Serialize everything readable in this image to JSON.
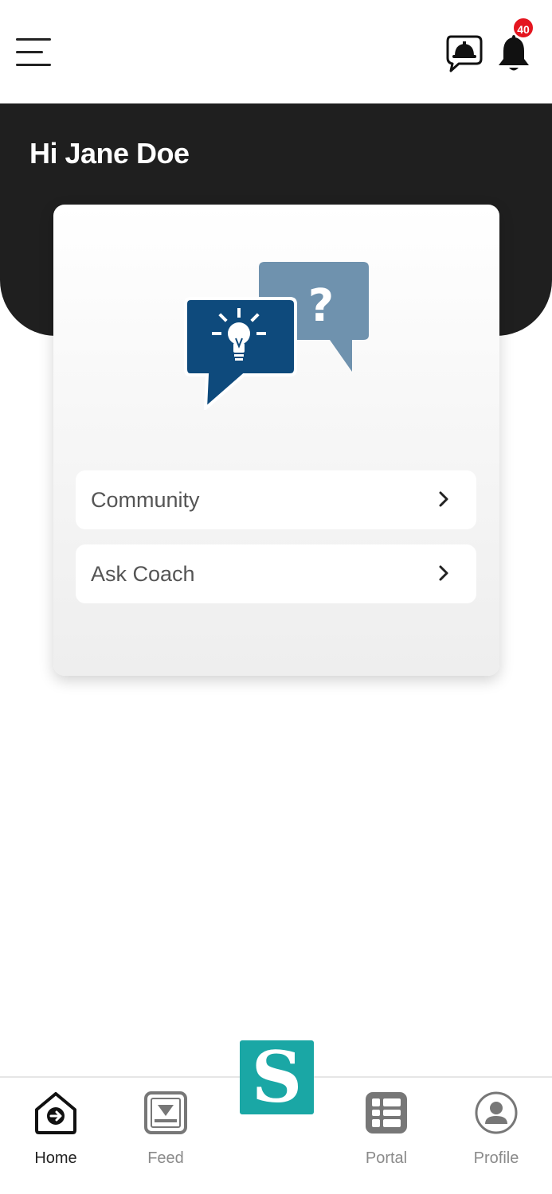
{
  "header": {
    "notification_count": "40",
    "icons": {
      "menu": "hamburger-menu-icon",
      "chat": "helmet-chat-icon",
      "notifications": "bell-icon"
    }
  },
  "hero": {
    "greeting": "Hi Jane Doe"
  },
  "card": {
    "illustration": "idea-question-bubbles-icon",
    "items": [
      {
        "label": "Community"
      },
      {
        "label": "Ask Coach"
      }
    ]
  },
  "bottom_nav": {
    "items": [
      {
        "label": "Home",
        "icon": "home-arrow-icon",
        "active": true
      },
      {
        "label": "Feed",
        "icon": "feed-tray-icon",
        "active": false
      },
      {
        "label": "Portal",
        "icon": "portal-grid-icon",
        "active": false
      },
      {
        "label": "Profile",
        "icon": "profile-user-icon",
        "active": false
      }
    ],
    "center_logo": "S"
  },
  "colors": {
    "hero_bg": "#1f1f1f",
    "badge": "#e4151f",
    "bubble_dark": "#0e4a7c",
    "bubble_light": "#6f92ae",
    "logo_bg": "#1aa7a5"
  }
}
